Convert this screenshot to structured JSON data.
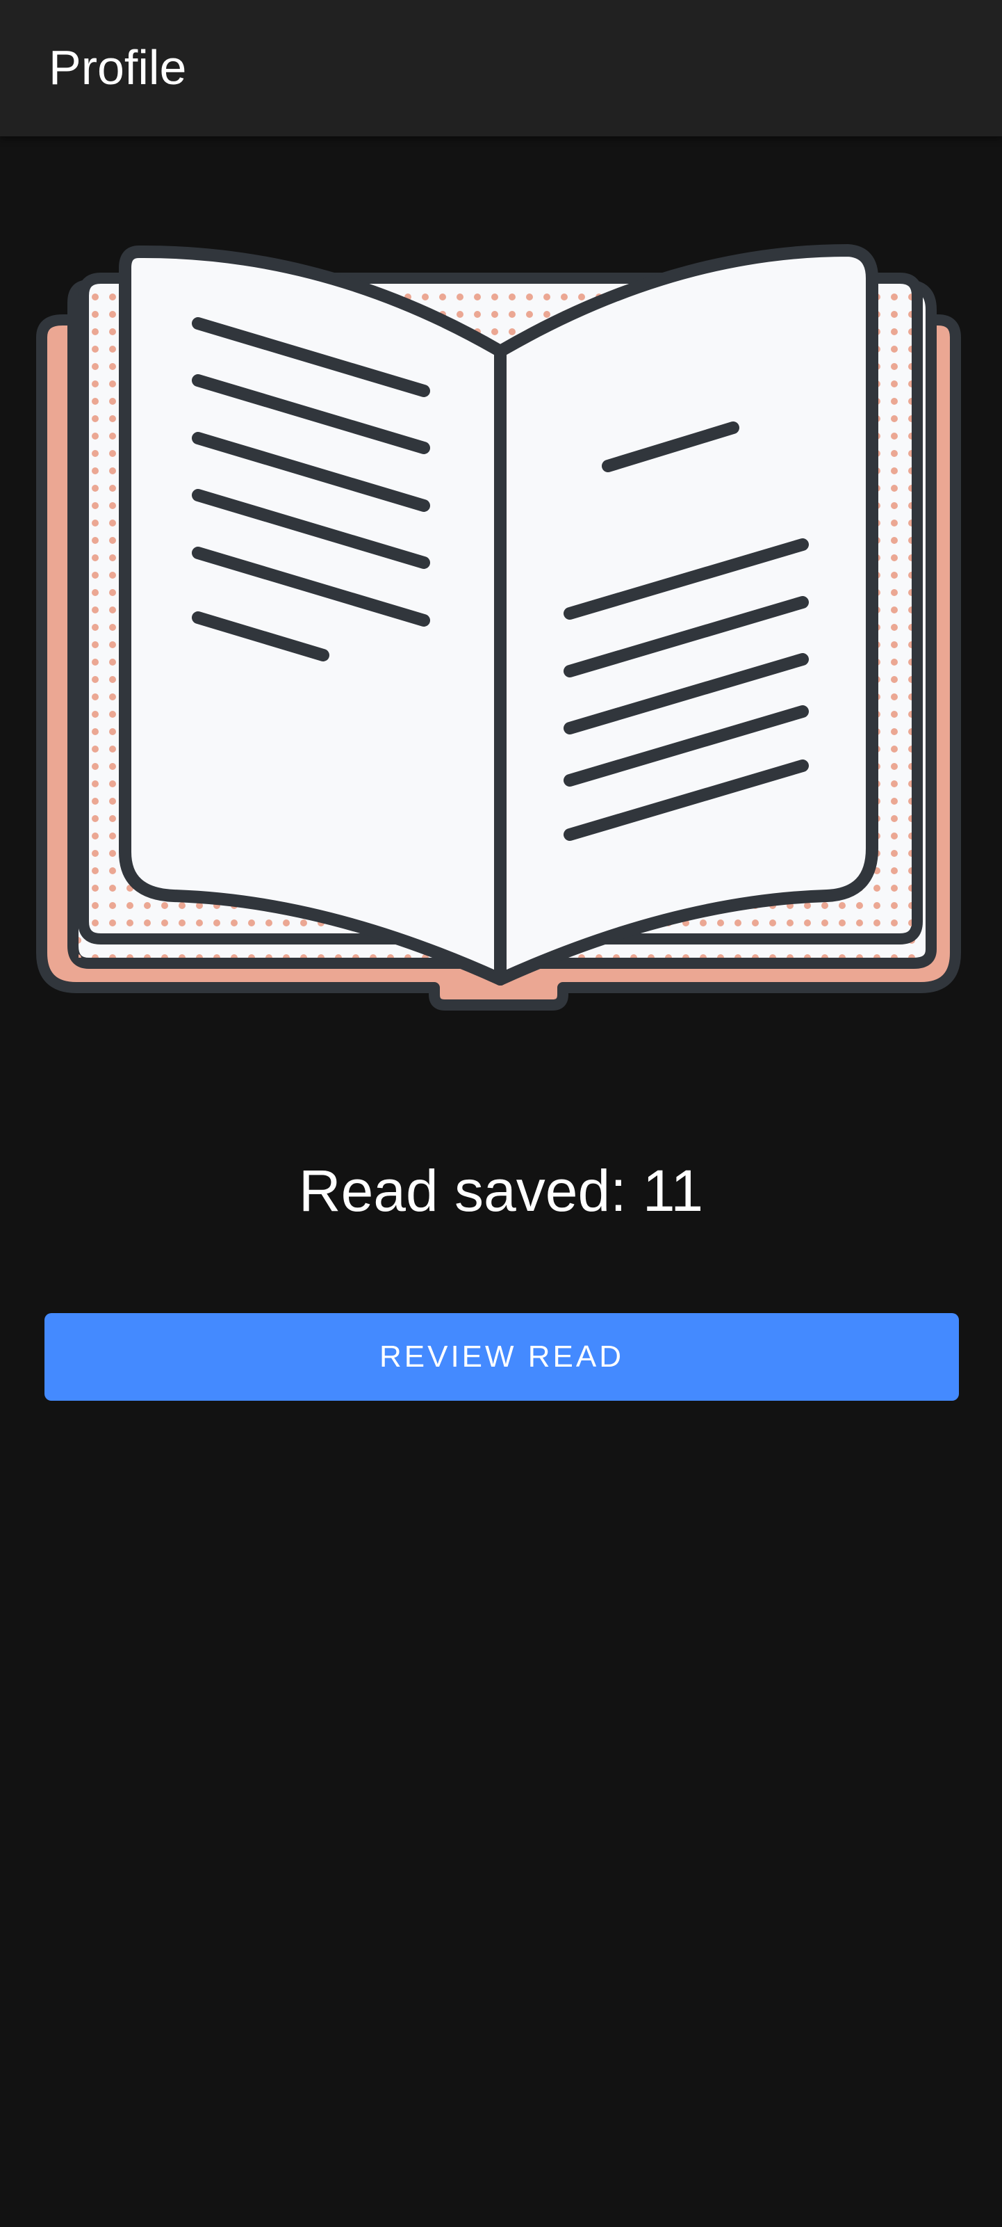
{
  "app_bar": {
    "title": "Profile"
  },
  "illustration": {
    "icon": "open-book-icon",
    "cover_color": "#eba793",
    "page_color": "#f8f9fb",
    "outline_color": "#31363c"
  },
  "stats": {
    "read_saved_text": "Read saved: 11"
  },
  "actions": {
    "review_label": "REVIEW READ",
    "accent_color": "#448aff"
  }
}
